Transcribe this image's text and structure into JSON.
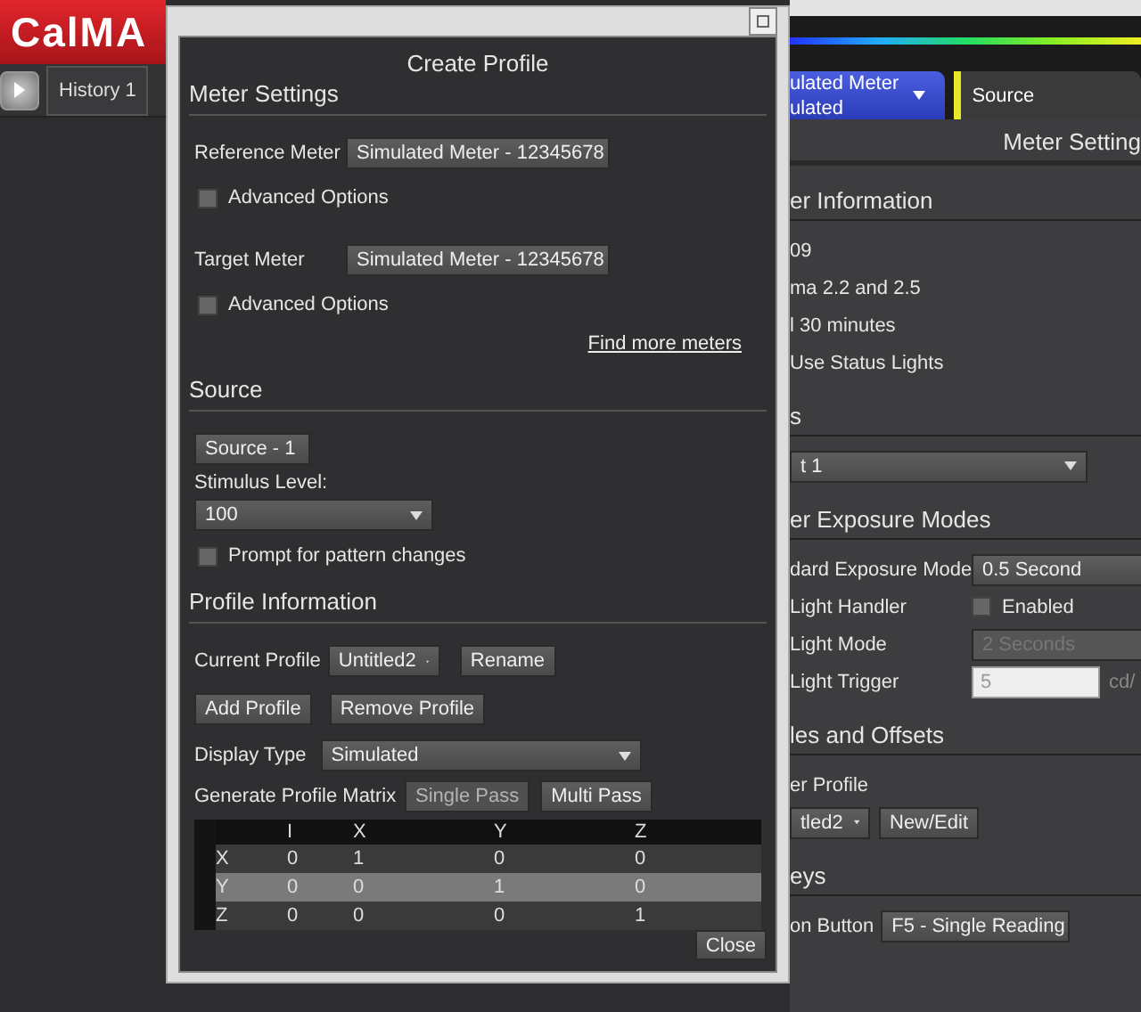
{
  "app": {
    "logo": "CalMA",
    "history_tab": "History 1"
  },
  "right_tabs": [
    {
      "kind": "meter",
      "lines": [
        "ulated Meter",
        "ulated"
      ]
    },
    {
      "kind": "source",
      "lines": [
        "Source"
      ]
    }
  ],
  "right_panel": {
    "title": "Meter Setting",
    "sections": [
      {
        "header": "er Information",
        "rows": [
          {
            "kind": "text",
            "label": "09"
          },
          {
            "kind": "text",
            "label": "ma 2.2 and 2.5"
          },
          {
            "kind": "text",
            "label": "l 30 minutes"
          },
          {
            "kind": "text",
            "label": "Use Status Lights"
          }
        ]
      },
      {
        "header": "s",
        "rows": [
          {
            "kind": "wide_dropdown",
            "value": "t 1"
          }
        ]
      },
      {
        "header": "er Exposure Modes",
        "rows": [
          {
            "kind": "dropdown",
            "label": "dard Exposure Mode",
            "value": "0.5 Second"
          },
          {
            "kind": "checkbox",
            "label": "Light Handler",
            "value": "Enabled",
            "checked": false
          },
          {
            "kind": "dropdown",
            "label": "Light Mode",
            "value": "2 Seconds",
            "disabled": true
          },
          {
            "kind": "input",
            "label": "Light Trigger",
            "placeholder": "5",
            "unit": "cd/"
          }
        ]
      },
      {
        "header": "les and Offsets",
        "rows": [
          {
            "kind": "text",
            "label": "er Profile"
          },
          {
            "kind": "dropdown_button",
            "value": "tled2",
            "button": "New/Edit"
          }
        ]
      },
      {
        "header": "eys",
        "rows": [
          {
            "kind": "inline_dropdown",
            "label": "on Button",
            "value": "F5 - Single Reading"
          }
        ]
      }
    ]
  },
  "dialog": {
    "title": "Create Profile",
    "meter_settings": {
      "header": "Meter Settings",
      "meters": [
        {
          "label": "Reference Meter",
          "value": "Simulated Meter - 12345678",
          "advanced": {
            "label": "Advanced Options",
            "checked": false
          }
        },
        {
          "label": "Target Meter",
          "value": "Simulated Meter - 12345678",
          "advanced": {
            "label": "Advanced Options",
            "checked": false
          }
        }
      ],
      "link": "Find more meters"
    },
    "source": {
      "header": "Source",
      "source": "Source - 1",
      "stimulus_label": "Stimulus Level:",
      "stimulus": "100",
      "prompt": {
        "label": "Prompt for pattern changes",
        "checked": false
      }
    },
    "profile": {
      "header": "Profile Information",
      "current_label": "Current Profile",
      "current": "Untitled2",
      "rename": "Rename",
      "add": "Add Profile",
      "remove": "Remove Profile",
      "display_label": "Display Type",
      "display": "Simulated",
      "generate_label": "Generate Profile Matrix",
      "generate_buttons": [
        {
          "label": "Single Pass",
          "disabled": true
        },
        {
          "label": "Multi Pass",
          "disabled": false
        }
      ]
    },
    "matrix": {
      "columns": [
        "I",
        "X",
        "Y",
        "Z"
      ],
      "rows": [
        {
          "label": "X",
          "values": [
            "0",
            "1",
            "0",
            "0"
          ],
          "selected": false
        },
        {
          "label": "Y",
          "values": [
            "0",
            "0",
            "1",
            "0"
          ],
          "selected": true
        },
        {
          "label": "Z",
          "values": [
            "0",
            "0",
            "0",
            "1"
          ],
          "selected": false
        }
      ]
    },
    "close": "Close"
  }
}
